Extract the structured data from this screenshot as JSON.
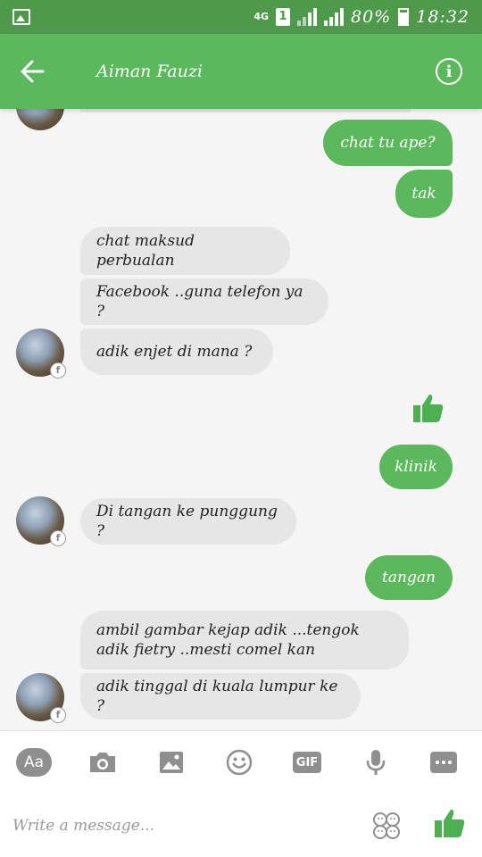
{
  "status_bar": {
    "network": "4G",
    "sim": "1",
    "battery": "80%",
    "time": "18:32"
  },
  "header": {
    "contact_name": "Aiman Fauzi",
    "back_icon": "arrow-left-icon",
    "info_icon": "info-icon"
  },
  "colors": {
    "brand_green": "#5cb85c",
    "status_green": "#4f9a4a",
    "incoming_bubble": "#e6e6e6"
  },
  "messages": [
    {
      "side": "out",
      "text": "chat tu ape?"
    },
    {
      "side": "out",
      "text": "tak"
    },
    {
      "side": "in",
      "text": "chat maksud perbualan"
    },
    {
      "side": "in",
      "text": "Facebook ..guna telefon ya ?"
    },
    {
      "side": "in",
      "text": "adik enjet di mana ?"
    },
    {
      "side": "out",
      "type": "like",
      "icon": "thumbs-up-icon"
    },
    {
      "side": "out",
      "text": "klinik"
    },
    {
      "side": "in",
      "text": "Di tangan ke punggung ?"
    },
    {
      "side": "out",
      "text": "tangan"
    },
    {
      "side": "in",
      "text": "ambil gambar kejap adik ...tengok adik fietry ..mesti comel kan"
    },
    {
      "side": "in",
      "text": "adik tinggal di kuala lumpur ke ?"
    }
  ],
  "composer": {
    "aa_label": "Aa",
    "gif_label": "GIF",
    "placeholder": "Write a message...",
    "tools": [
      "aa-icon",
      "camera-icon",
      "image-icon",
      "emoji-icon",
      "gif-icon",
      "microphone-icon",
      "more-icon"
    ],
    "sticker_icon": "sticker-icon",
    "send_icon": "thumbs-up-icon"
  }
}
